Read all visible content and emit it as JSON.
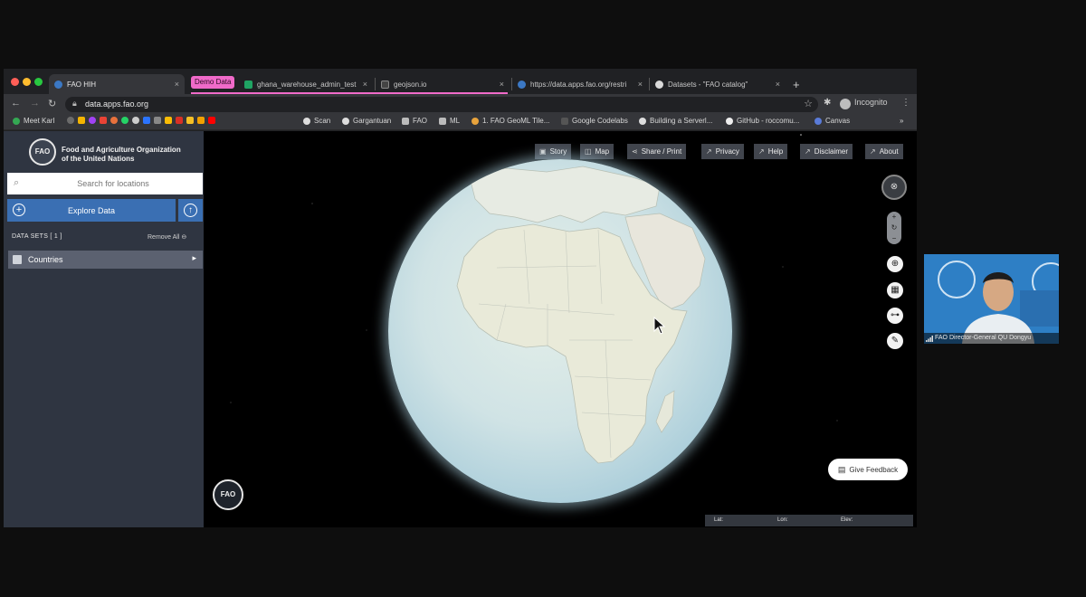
{
  "browser": {
    "tabs": [
      {
        "label": "FAO HIH",
        "close": "×"
      },
      {
        "label": "ghana_warehouse_admin_test",
        "close": "×"
      },
      {
        "label": "geojson.io",
        "close": "×"
      },
      {
        "label": "https://data.apps.fao.org/restri",
        "close": "×"
      },
      {
        "label": "Datasets - \"FAO catalog\"",
        "close": "×"
      }
    ],
    "tab_group_label": "Demo Data",
    "new_tab": "+",
    "url": "data.apps.fao.org",
    "profile_label": "Incognito",
    "bookmarks": [
      "Meet Karl",
      "Scan",
      "Gargantuan",
      "FAO",
      "ML",
      "1. FAO GeoML Tile...",
      "Google Codelabs",
      "Building a Serverl...",
      "GitHub - roccomu...",
      "Canvas"
    ],
    "bookmarks_more": "»"
  },
  "app": {
    "org_name_line1": "Food and Agriculture Organization",
    "org_name_line2": "of the United Nations",
    "logo_text": "FAO",
    "search": {
      "placeholder": "Search for locations"
    },
    "explore_label": "Explore Data",
    "datasets_header": "DATA SETS   [ 1 ]",
    "remove_all": "Remove All",
    "datasets": [
      {
        "label": "Countries"
      }
    ],
    "top_buttons": [
      {
        "label": "Story",
        "icon": "story-icon"
      },
      {
        "label": "Map",
        "icon": "map-icon"
      },
      {
        "label": "Share / Print",
        "icon": "share-icon"
      },
      {
        "label": "Privacy",
        "icon": "external-link-icon"
      },
      {
        "label": "Help",
        "icon": "external-link-icon"
      },
      {
        "label": "Disclaimer",
        "icon": "external-link-icon"
      },
      {
        "label": "About",
        "icon": "external-link-icon"
      }
    ],
    "feedback_label": "Give Feedback",
    "coords": {
      "lat": "Lat:",
      "lon": "Lon:",
      "elev": "Elev:"
    }
  },
  "video": {
    "caption": "FAO Director-General QU Dongyu"
  }
}
